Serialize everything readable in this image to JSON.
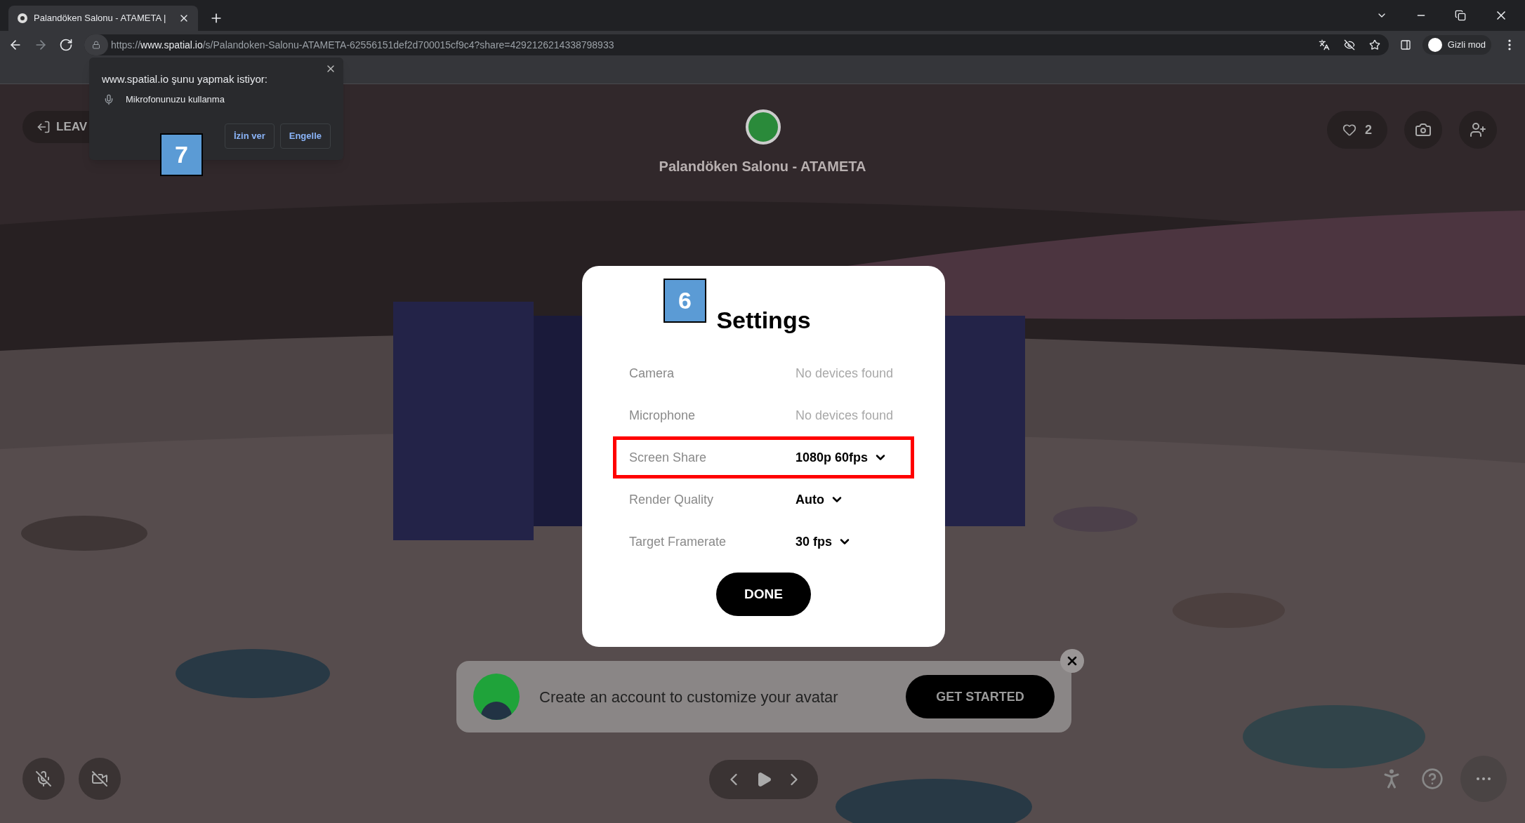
{
  "browser": {
    "tab": {
      "title": "Palandöken Salonu - ATAMETA |",
      "selected": true
    },
    "url": {
      "prefix": "https://",
      "host": "www.spatial.io",
      "path": "/s/Palandoken-Salonu-ATAMETA-62556151def2d700015cf9c4?share=4292126214338798933"
    },
    "profile": "Gizli mod"
  },
  "permission_popup": {
    "title": "www.spatial.io şunu yapmak istiyor:",
    "request": "Mikrofonunuzu kullanma",
    "buttons": [
      "İzin ver",
      "Engelle"
    ]
  },
  "scene": {
    "leave_button": "LEAV",
    "room_title": "Palandöken Salonu - ATAMETA",
    "likes": "2"
  },
  "settings": {
    "title": "Settings",
    "rows": [
      {
        "label": "Camera",
        "value": "No devices found",
        "kind": "static",
        "highlighted": false
      },
      {
        "label": "Microphone",
        "value": "No devices found",
        "kind": "static",
        "highlighted": false
      },
      {
        "label": "Screen Share",
        "value": "1080p 60fps",
        "kind": "dropdown",
        "highlighted": true
      },
      {
        "label": "Render Quality",
        "value": "Auto",
        "kind": "dropdown",
        "highlighted": false
      },
      {
        "label": "Target Framerate",
        "value": "30 fps",
        "kind": "dropdown",
        "highlighted": false
      }
    ],
    "done": "DONE"
  },
  "banner": {
    "text": "Create an account to customize your avatar",
    "button": "GET STARTED"
  },
  "annotations": [
    "6",
    "7"
  ]
}
